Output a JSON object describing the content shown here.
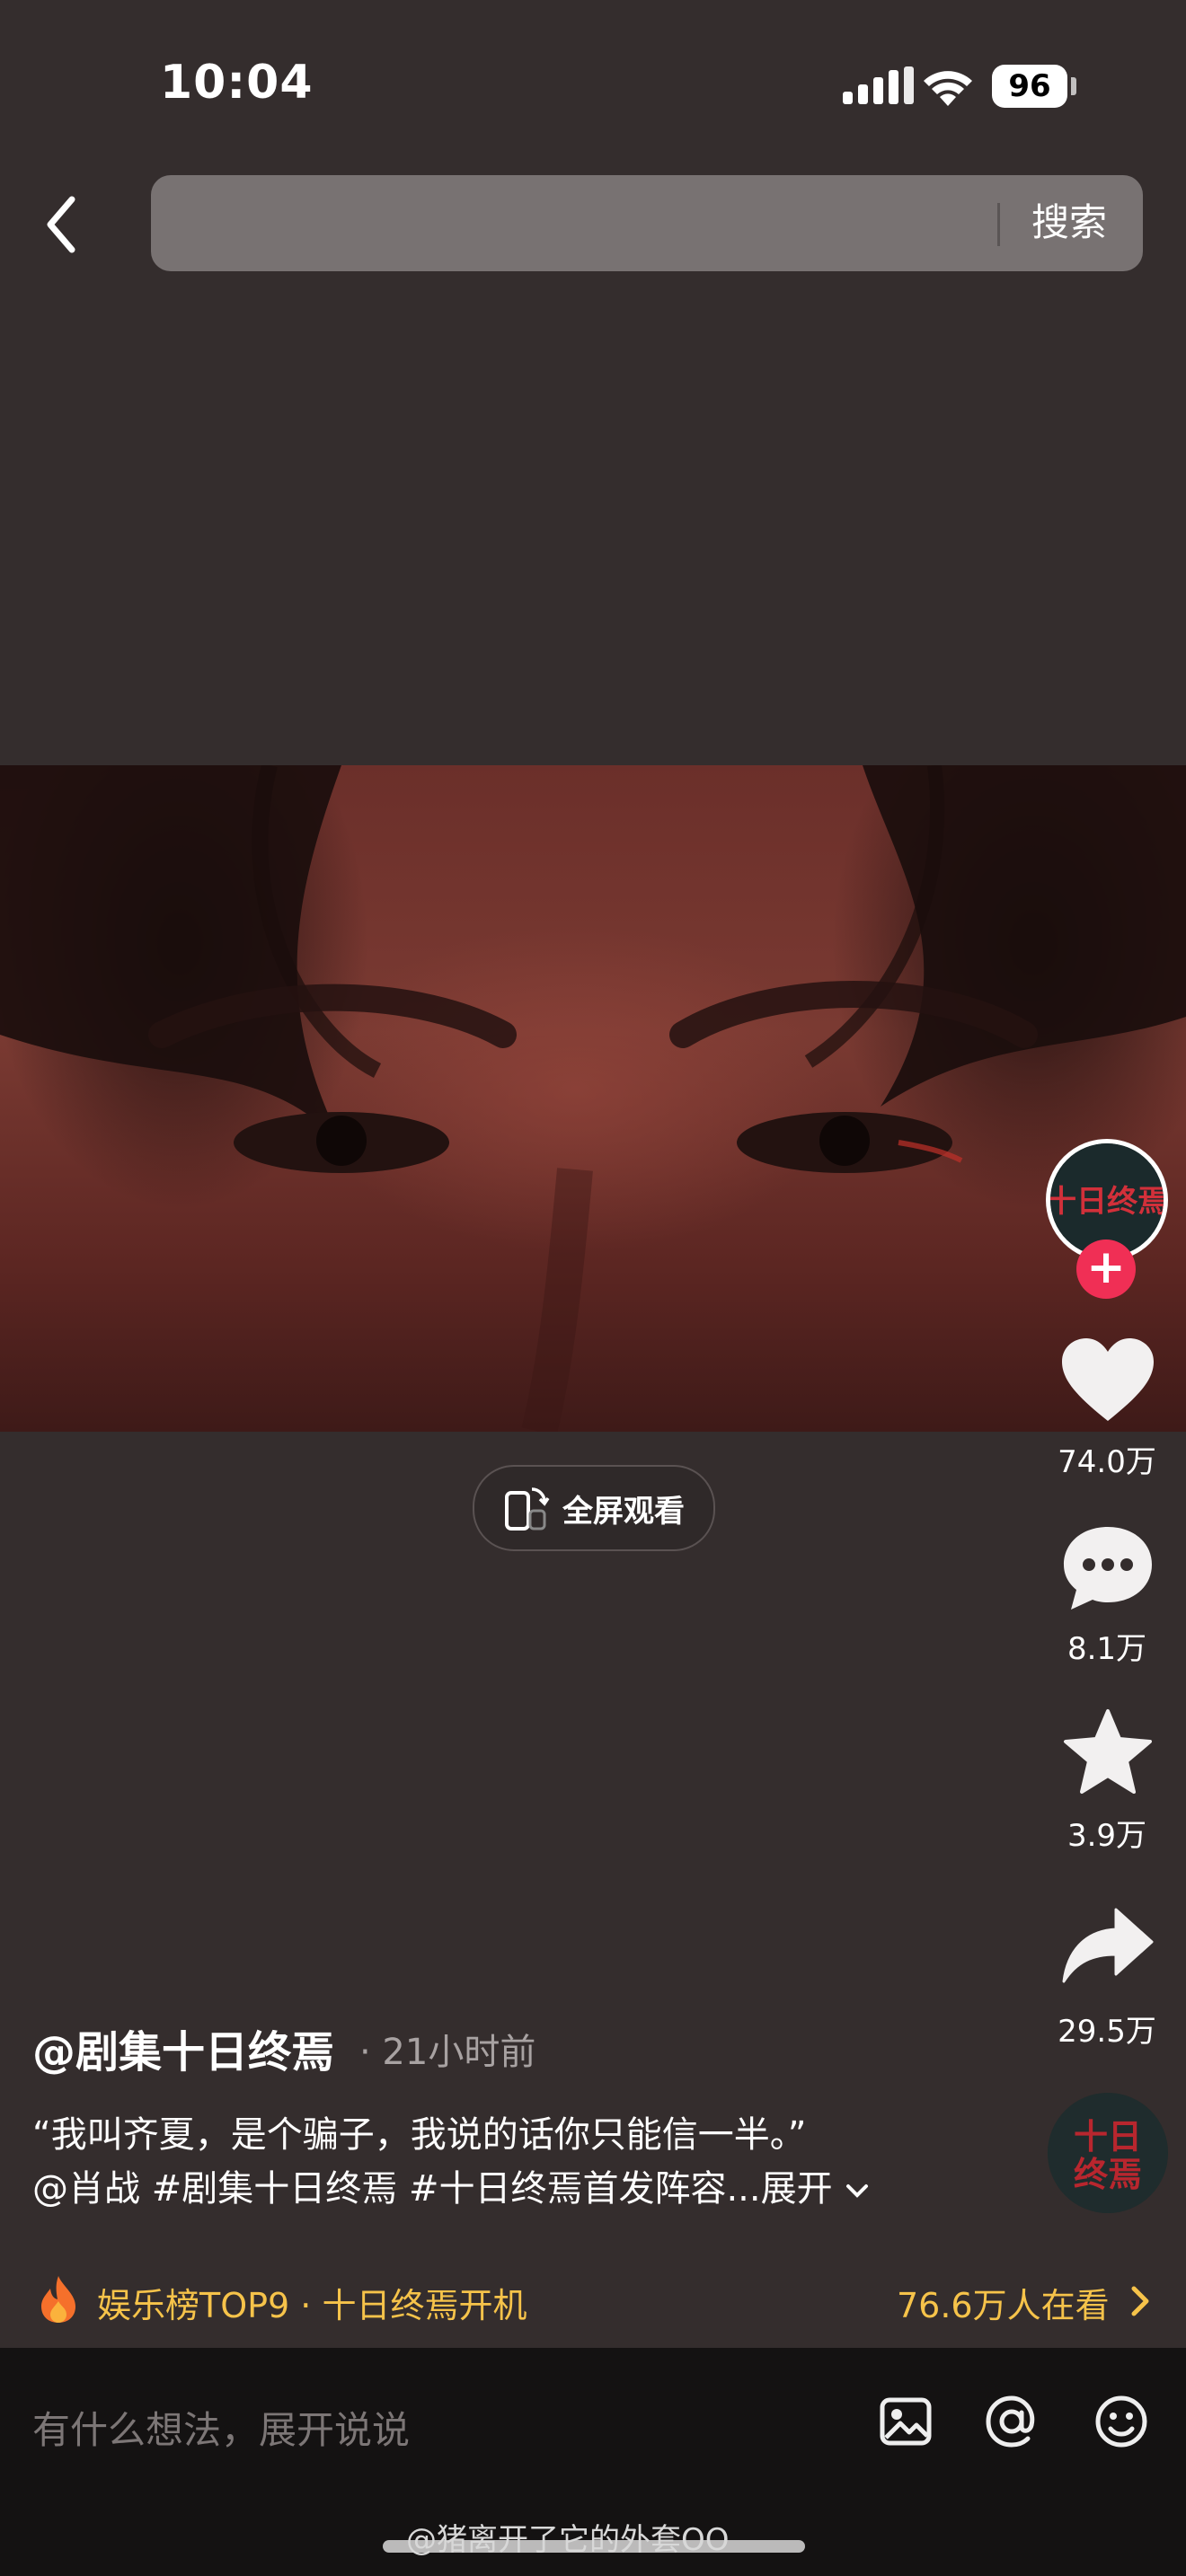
{
  "status_bar": {
    "time": "10:04",
    "battery": "96"
  },
  "header": {
    "search_placeholder": "",
    "search_button": "搜索"
  },
  "video": {
    "fullscreen_label": "全屏观看"
  },
  "actions": {
    "likes": "74.0万",
    "comments": "8.1万",
    "favorites": "3.9万",
    "shares": "29.5万",
    "avatar_text": "十日终焉"
  },
  "post": {
    "author": "@剧集十日终焉",
    "time": "· 21小时前",
    "caption_line1": "“我叫齐夏，是个骗子，我说的话你只能信一半。”",
    "caption_line2": "@肖战 #剧集十日终焉 #十日终焉首发阵容...展开"
  },
  "trending": {
    "label": "娱乐榜TOP9 · 十日终焉开机",
    "viewers": "76.6万人在看"
  },
  "comment_bar": {
    "placeholder": "有什么想法，展开说说"
  },
  "watermark": "@猪离开了它的外套OO",
  "colors": {
    "accent_red": "#f02f55",
    "trending_gold": "#f6c34a",
    "background": "#342d2d"
  }
}
